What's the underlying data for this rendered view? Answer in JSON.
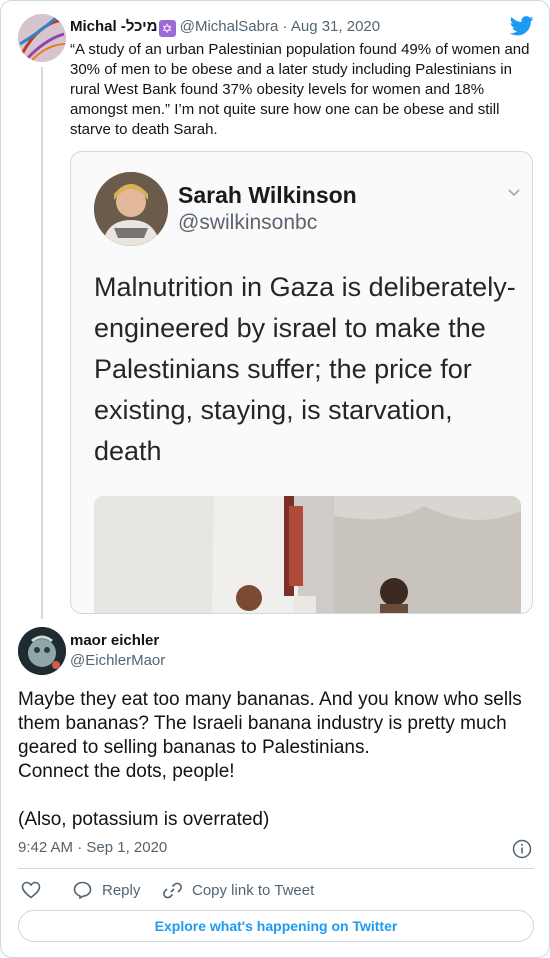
{
  "parent_tweet": {
    "display_name": "Michal -מיכל",
    "badge_icon": "star-of-david-icon",
    "handle": "@MichalSabra",
    "separator": "·",
    "date": "Aug 31, 2020",
    "text": "“A study of an urban Palestinian population found 49% of women and 30% of men to be obese and a later study including Palestinians in rural West Bank found 37% obesity levels for women and 18% amongst men.” I’m not quite sure how one can be obese and still starve to death Sarah.",
    "quoted_screenshot": {
      "name": "Sarah Wilkinson",
      "handle": "@swilkinsonbc",
      "text": "Malnutrition in Gaza is deliberately-engineered by israel to make the Palestinians suffer; the price for existing, staying, is starvation, death"
    }
  },
  "reply_tweet": {
    "display_name": "maor eichler",
    "handle": "@EichlerMaor",
    "text": "Maybe they eat too many bananas. And you know who sells them bananas? The Israeli banana industry is pretty much geared to selling bananas to Palestinians.\nConnect the dots, people!\n\n(Also, potassium is overrated)",
    "timestamp": "9:42 AM · Sep 1, 2020"
  },
  "actions": {
    "reply_label": "Reply",
    "copy_label": "Copy link to Tweet"
  },
  "explore_label": "Explore what's happening on Twitter",
  "colors": {
    "twitter_blue": "#1d9bf0",
    "text_primary": "#0f1419",
    "text_secondary": "#536471",
    "border": "#cfd9de"
  }
}
